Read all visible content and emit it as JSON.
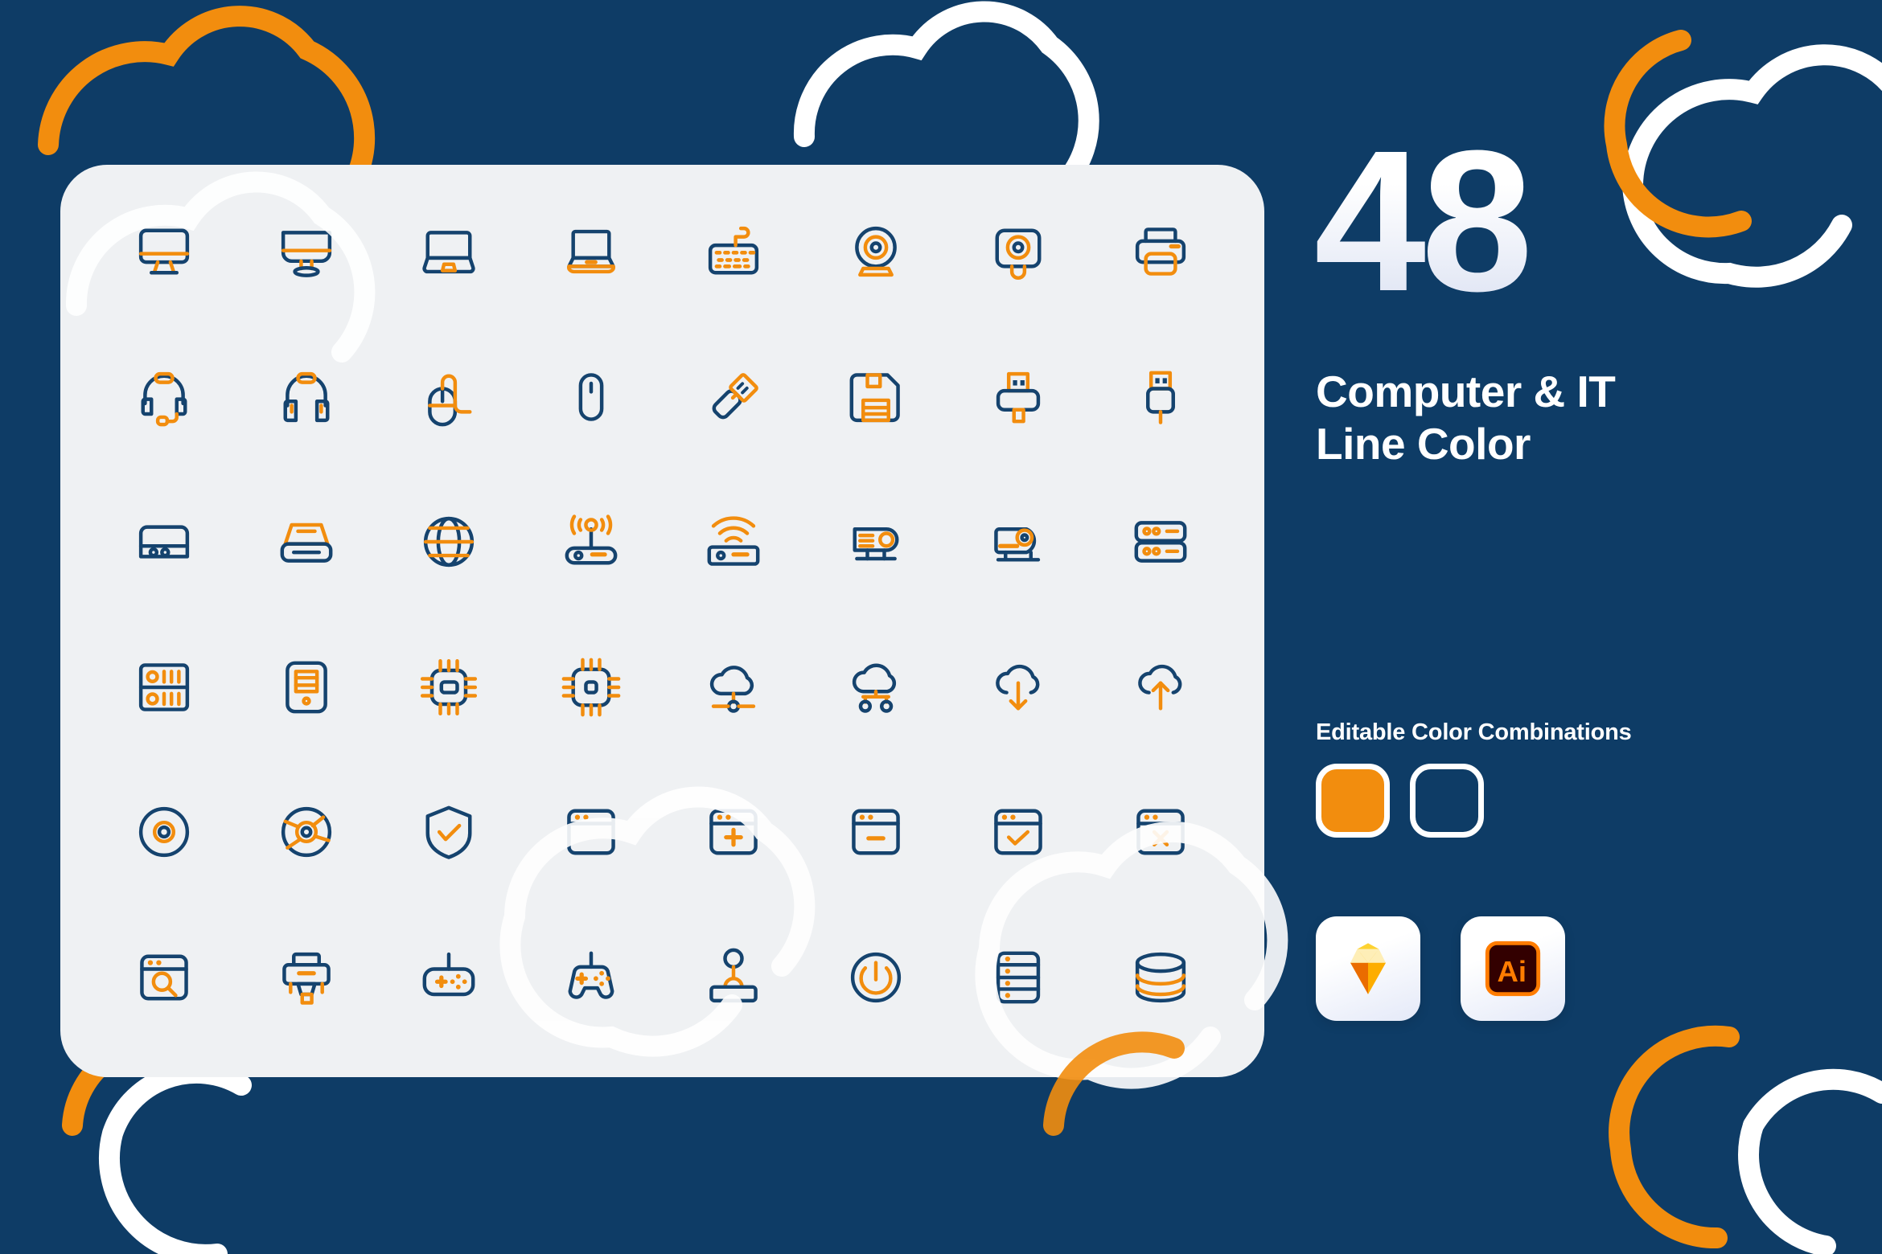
{
  "theme": {
    "background": "#0e3c66",
    "card_background": "#eff1f3",
    "line_navy": "#15436e",
    "line_orange": "#f28d0e",
    "white": "#ffffff"
  },
  "right_panel": {
    "count": "48",
    "title_line1": "Computer & IT",
    "title_line2": "Line Color",
    "combos_label": "Editable Color Combinations",
    "swatches": [
      {
        "name": "orange-swatch",
        "color": "#f28d0e",
        "filled": true
      },
      {
        "name": "outline-swatch",
        "color": "#0e3c66",
        "filled": false
      }
    ],
    "apps": [
      {
        "name": "sketch-app-icon",
        "label": "Sketch"
      },
      {
        "name": "illustrator-app-icon",
        "label": "Ai"
      }
    ]
  },
  "icon_grid": {
    "columns": 8,
    "rows": 6,
    "icons": [
      "desktop-monitor-icon",
      "desktop-monitor-stand-icon",
      "laptop-closed-icon",
      "laptop-open-icon",
      "keyboard-icon",
      "webcam-icon",
      "security-camera-icon",
      "printer-icon",
      "headset-icon",
      "headphones-icon",
      "mouse-cable-icon",
      "mouse-icon",
      "usb-flash-drive-icon",
      "floppy-disk-icon",
      "usb-connector-icon",
      "usb-plug-icon",
      "external-hard-drive-icon",
      "scanner-icon",
      "globe-network-icon",
      "router-antenna-icon",
      "wifi-modem-icon",
      "projector-icon",
      "projector-lens-icon",
      "server-rack-icon",
      "server-stack-icon",
      "pc-tower-icon",
      "processor-chip-icon",
      "cpu-chip-icon",
      "cloud-network-icon",
      "cloud-servers-icon",
      "cloud-download-icon",
      "cloud-upload-icon",
      "compact-disc-icon",
      "dvd-disc-icon",
      "shield-check-icon",
      "browser-window-icon",
      "browser-add-icon",
      "browser-remove-icon",
      "browser-check-icon",
      "browser-close-icon",
      "browser-search-icon",
      "3d-printer-icon",
      "gamepad-flat-icon",
      "game-controller-icon",
      "joystick-icon",
      "power-button-icon",
      "database-rack-icon",
      "database-cylinder-icon"
    ]
  }
}
